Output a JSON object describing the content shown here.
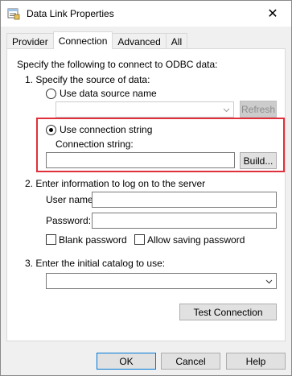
{
  "window": {
    "title": "Data Link Properties",
    "close_glyph": "✕"
  },
  "tabs": [
    {
      "label": "Provider",
      "active": false
    },
    {
      "label": "Connection",
      "active": true
    },
    {
      "label": "Advanced",
      "active": false
    },
    {
      "label": "All",
      "active": false
    }
  ],
  "connection": {
    "intro": "Specify the following to connect to ODBC data:",
    "step1": "1. Specify the source of data:",
    "use_dsn_label": "Use data source name",
    "dsn_value": "",
    "refresh_label": "Refresh",
    "use_connstr_label": "Use connection string",
    "connstr_caption": "Connection string:",
    "connstr_value": "",
    "build_label": "Build...",
    "step2": "2. Enter information to log on to the server",
    "username_label": "User name:",
    "username_value": "",
    "password_label": "Password:",
    "password_value": "",
    "blank_password_label": "Blank password",
    "allow_saving_label": "Allow saving password",
    "step3": "3. Enter the initial catalog to use:",
    "catalog_value": "",
    "test_connection_label": "Test Connection"
  },
  "footer": {
    "ok_label": "OK",
    "cancel_label": "Cancel",
    "help_label": "Help"
  },
  "colors": {
    "highlight": "#e0303b",
    "dialog_bg": "#f0f0f0",
    "default_button_border": "#0078d7"
  },
  "icons": {
    "app": "data-link-icon",
    "chevron": "chevron-down-icon"
  }
}
